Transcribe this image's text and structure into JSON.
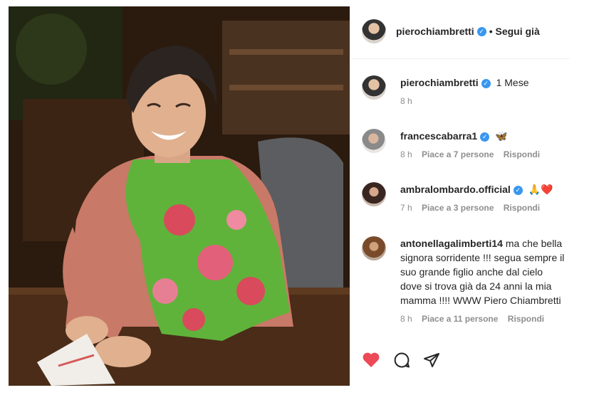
{
  "post": {
    "author": "pierochiambretti",
    "follow_status": "• Segui già"
  },
  "comments": [
    {
      "user": "pierochiambretti",
      "verified": true,
      "text": "1 Mese",
      "time": "8 h",
      "likes": "",
      "reply": ""
    },
    {
      "user": "francescabarra1",
      "verified": true,
      "text": "🦋",
      "time": "8 h",
      "likes": "Piace a 7 persone",
      "reply": "Rispondi"
    },
    {
      "user": "ambralombardo.official",
      "verified": true,
      "text": "🙏❤️",
      "time": "7 h",
      "likes": "Piace a 3 persone",
      "reply": "Rispondi"
    },
    {
      "user": "antonellagalimberti14",
      "verified": false,
      "text": "ma che bella signora sorridente !!! segua sempre il suo grande figlio anche dal cielo dove si trova già da 24 anni la mia mamma !!!! WWW Piero Chiambretti",
      "time": "8 h",
      "likes": "Piace a 11 persone",
      "reply": "Rispondi"
    }
  ],
  "icons": {
    "like": "heart-icon",
    "comment": "comment-icon",
    "share": "share-icon"
  },
  "colors": {
    "like": "#ed4956",
    "verified": "#3897f0",
    "meta": "#8e8e8e"
  }
}
